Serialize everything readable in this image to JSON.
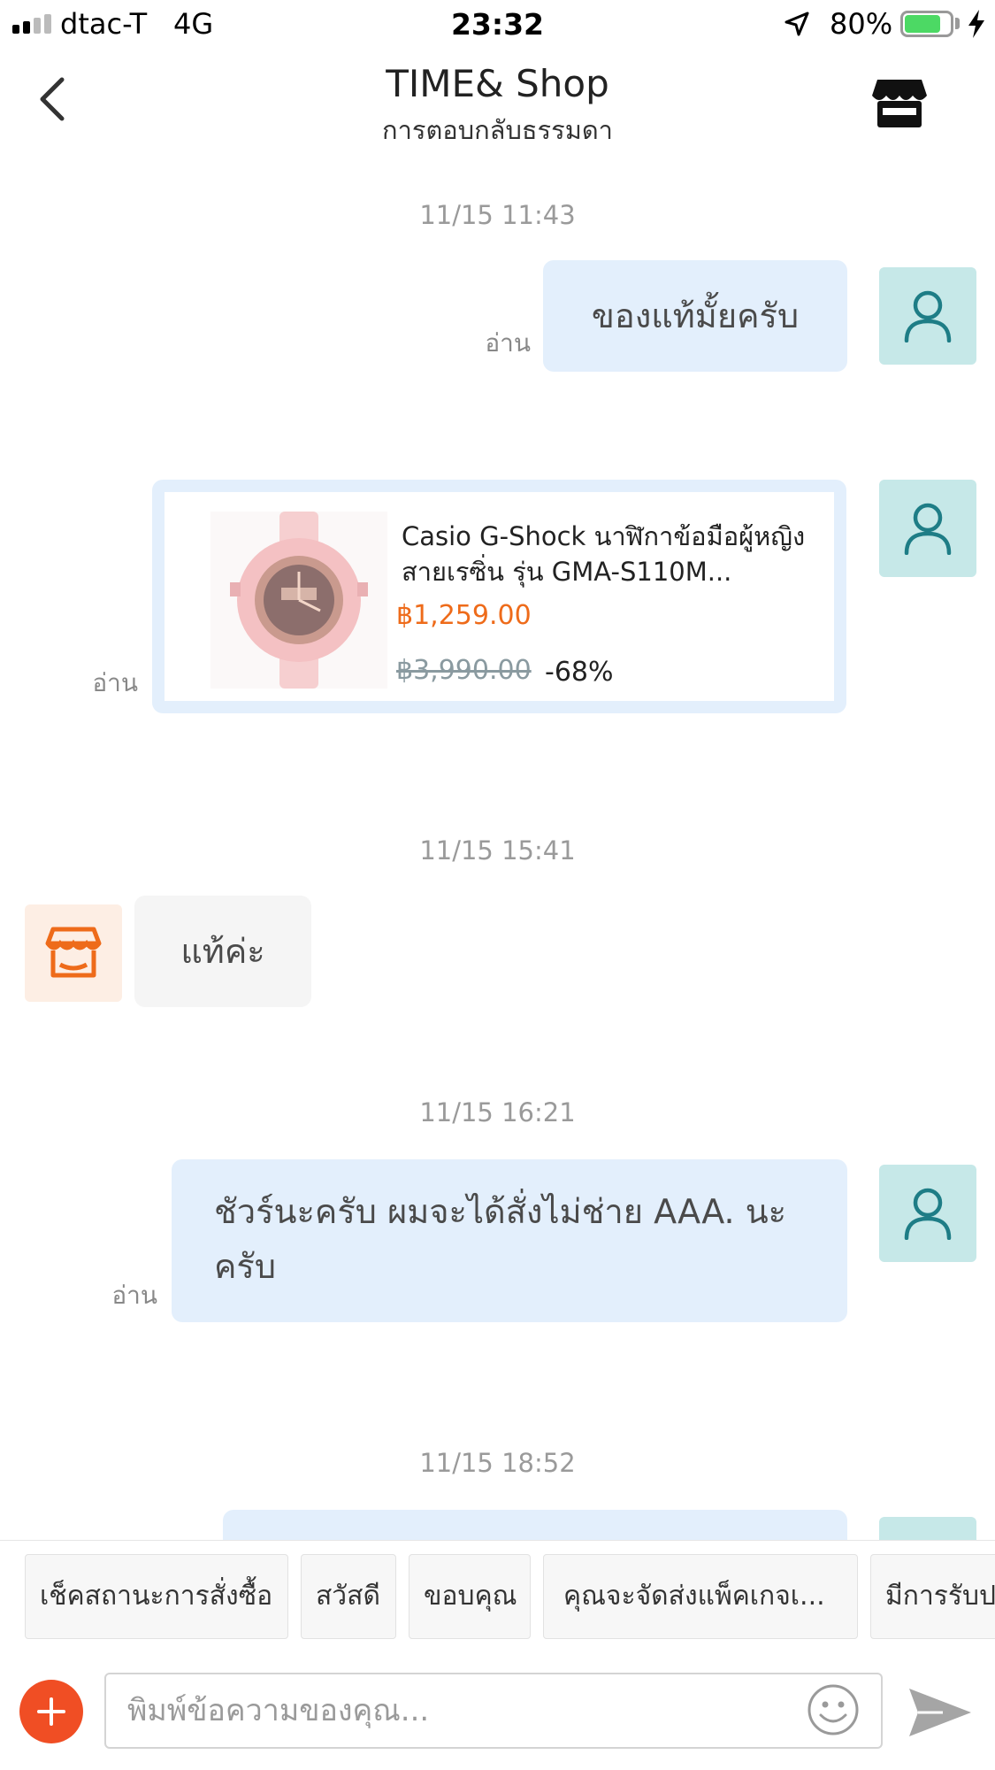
{
  "status_bar": {
    "carrier": "dtac-T",
    "network": "4G",
    "time": "23:32",
    "battery": "80%",
    "battery_level": 0.8
  },
  "header": {
    "title": "TIME& Shop",
    "subtitle": "การตอบกลับธรรมดา"
  },
  "messages": [
    {
      "timestamp": "11/15 11:43",
      "text": "ของแท้มั้ยครับ",
      "status": "อ่าน"
    },
    {
      "product": {
        "name": "Casio G-Shock  นาฬิกาข้อมือผู้หญิง สายเรซิ่น รุ่น GMA-S110M...",
        "price": "฿1,259.00",
        "original_price": "฿3,990.00",
        "discount": "-68%"
      },
      "status": "อ่าน"
    },
    {
      "timestamp": "11/15 15:41",
      "text": "แท้ค่ะ"
    },
    {
      "timestamp": "11/15 16:21",
      "text": "ชัวร์นะครับ ผมจะได้สั่งไม่ช่าย AAA. นะครับ",
      "status": "อ่าน"
    },
    {
      "timestamp": "11/15 18:52"
    }
  ],
  "quick_replies": [
    "เช็คสถานะการสั่งซื้อ",
    "สวัสดี",
    "ขอบคุณ",
    "คุณจะจัดส่งแพ็คเกจเ...",
    "มีการรับป"
  ],
  "input": {
    "placeholder": "พิมพ์ข้อความของคุณ..."
  },
  "colors": {
    "accent": "#ee6b1a",
    "my_bubble": "#e3effc",
    "user_avatar_bg": "#c6e8e8",
    "send_button": "#f04e24"
  }
}
